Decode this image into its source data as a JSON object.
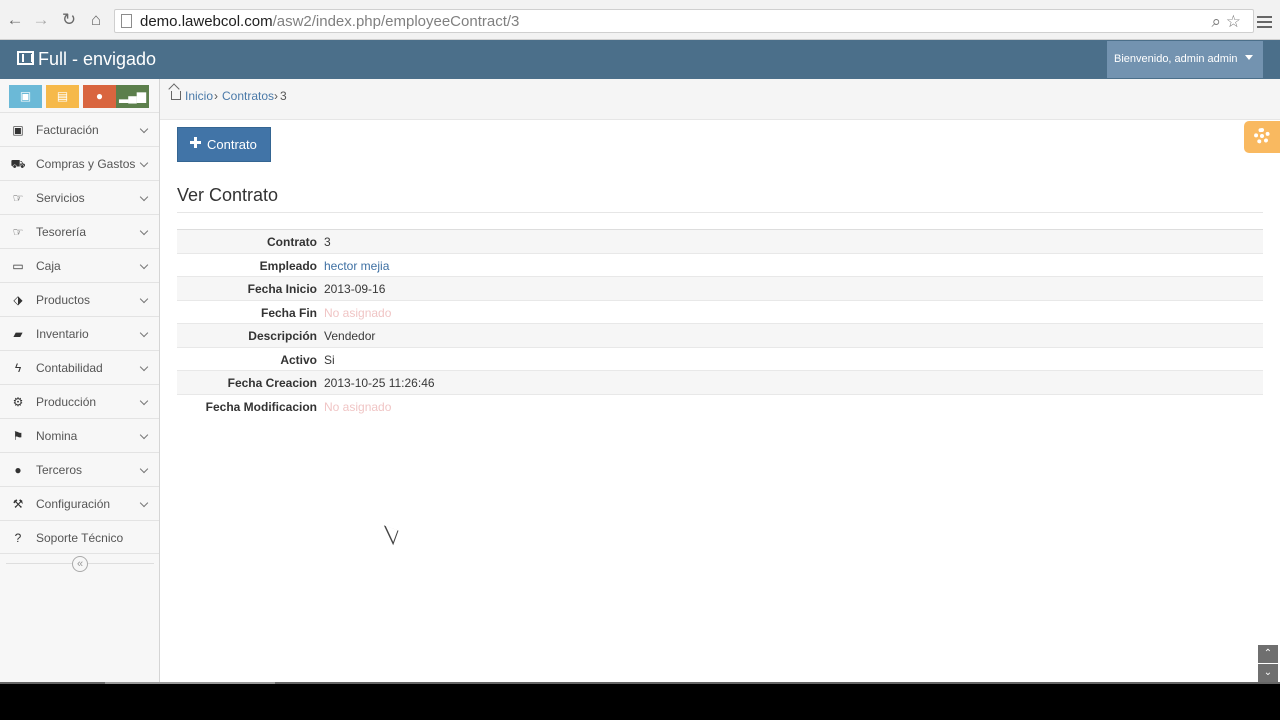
{
  "browser": {
    "url_host": "demo.lawebcol.com",
    "url_path": "/asw2/index.php/employeeContract/3"
  },
  "app": {
    "title": "Full - envigado",
    "user": "Bienvenido, admin admin",
    "brand_color": "#4b6f8a"
  },
  "shortcuts": [
    {
      "name": "billing-shortcut",
      "color": "#6bb9d7"
    },
    {
      "name": "cart-shortcut",
      "color": "#f6b94a"
    },
    {
      "name": "users-shortcut",
      "color": "#d9653f"
    },
    {
      "name": "charts-shortcut",
      "color": "#5c7f4c"
    }
  ],
  "sidebar": {
    "items": [
      {
        "label": "Facturación",
        "icon": "billing-icon"
      },
      {
        "label": "Compras y Gastos",
        "icon": "cart-icon"
      },
      {
        "label": "Servicios",
        "icon": "hand-right-icon"
      },
      {
        "label": "Tesorería",
        "icon": "hand-right-icon"
      },
      {
        "label": "Caja",
        "icon": "inbox-icon"
      },
      {
        "label": "Productos",
        "icon": "tags-icon"
      },
      {
        "label": "Inventario",
        "icon": "briefcase-icon"
      },
      {
        "label": "Contabilidad",
        "icon": "bolt-icon"
      },
      {
        "label": "Producción",
        "icon": "gears-icon"
      },
      {
        "label": "Nomina",
        "icon": "flag-icon"
      },
      {
        "label": "Terceros",
        "icon": "user-icon"
      },
      {
        "label": "Configuración",
        "icon": "wrench-icon"
      },
      {
        "label": "Soporte Técnico",
        "icon": "question-icon"
      }
    ]
  },
  "breadcrumb": {
    "home": "Inicio",
    "section": "Contratos",
    "current": "3"
  },
  "main": {
    "add_button": "Contrato",
    "title": "Ver Contrato",
    "details": [
      {
        "label": "Contrato",
        "value": "3"
      },
      {
        "label": "Empleado",
        "value": "hector mejia"
      },
      {
        "label": "Fecha Inicio",
        "value": "2013-09-16"
      },
      {
        "label": "Fecha Fin",
        "value": "No asignado"
      },
      {
        "label": "Descripción",
        "value": "Vendedor"
      },
      {
        "label": "Activo",
        "value": "Si"
      },
      {
        "label": "Fecha Creacion",
        "value": "2013-10-25 11:26:46"
      },
      {
        "label": "Fecha Modificacion",
        "value": "No asignado"
      }
    ]
  }
}
